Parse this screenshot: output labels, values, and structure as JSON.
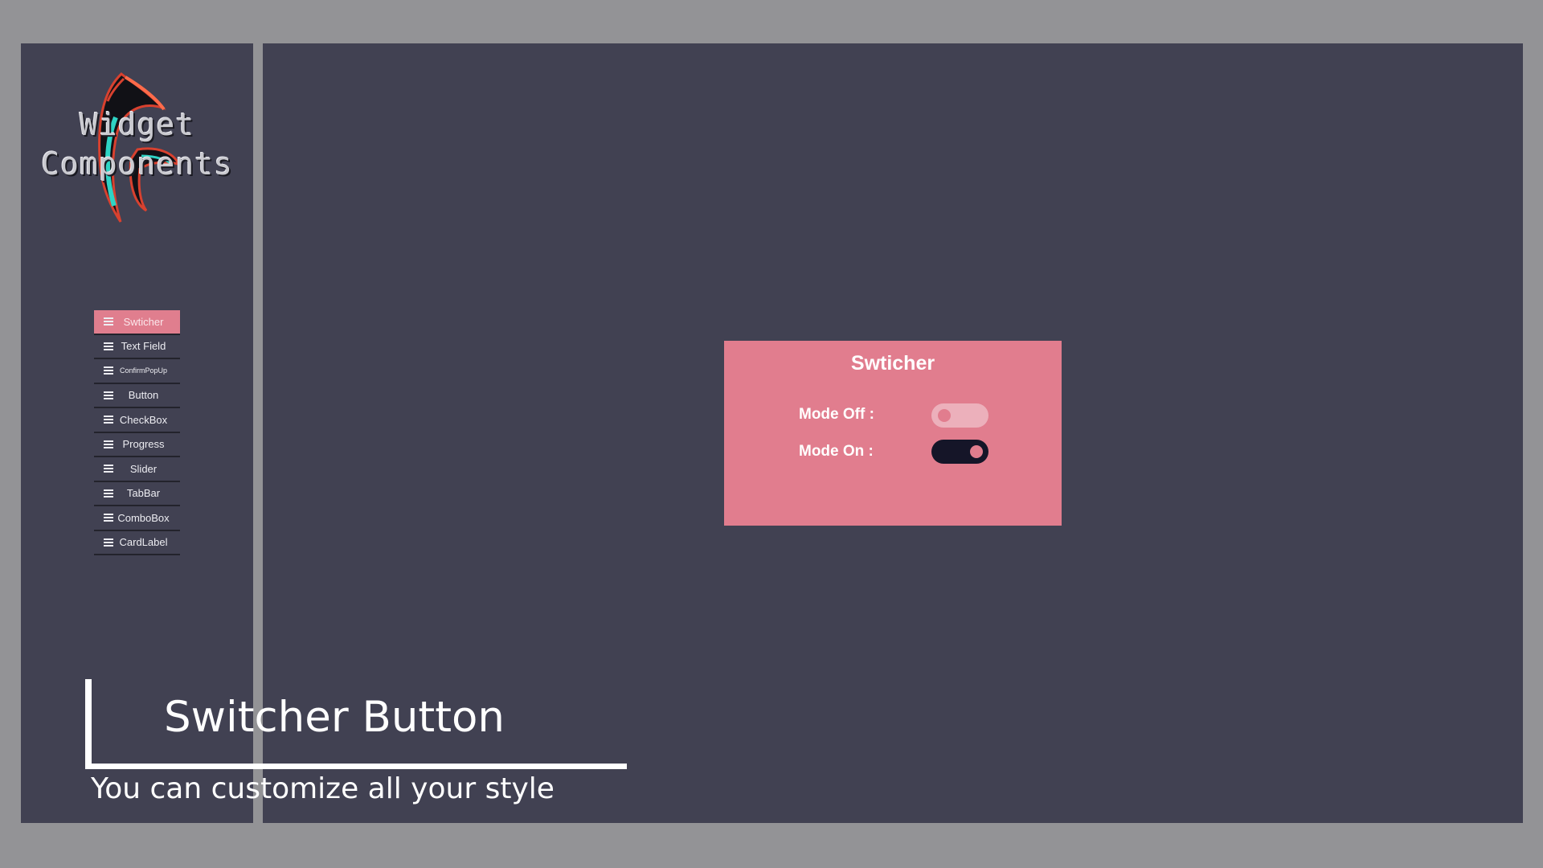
{
  "logo": {
    "line1": "Widget",
    "line2": "Components"
  },
  "menu": {
    "items": [
      {
        "label": "Swticher",
        "icon": "menu-lines-icon",
        "active": true
      },
      {
        "label": "Text Field",
        "icon": "menu-lines-icon"
      },
      {
        "label": "ConfirmPopUp",
        "icon": "menu-lines-icon"
      },
      {
        "label": "Button",
        "icon": "menu-lines-icon"
      },
      {
        "label": "CheckBox",
        "icon": "menu-lines-icon"
      },
      {
        "label": "Progress",
        "icon": "menu-lines-icon"
      },
      {
        "label": "Slider",
        "icon": "menu-lines-icon"
      },
      {
        "label": "TabBar",
        "icon": "menu-lines-icon"
      },
      {
        "label": "ComboBox",
        "icon": "menu-lines-icon"
      },
      {
        "label": "CardLabel",
        "icon": "menu-lines-icon"
      }
    ]
  },
  "card": {
    "title": "Swticher",
    "rows": [
      {
        "label": "Mode Off :",
        "state": "off"
      },
      {
        "label": "Mode On :",
        "state": "on"
      }
    ]
  },
  "caption": {
    "title": "Switcher Button",
    "subtitle": "You can customize all your style"
  },
  "colors": {
    "background": "#939396",
    "panel": "#414152",
    "accent": "#e07e8e",
    "toggle_off_track": "#ecb0bb",
    "toggle_on_track": "#151528"
  }
}
